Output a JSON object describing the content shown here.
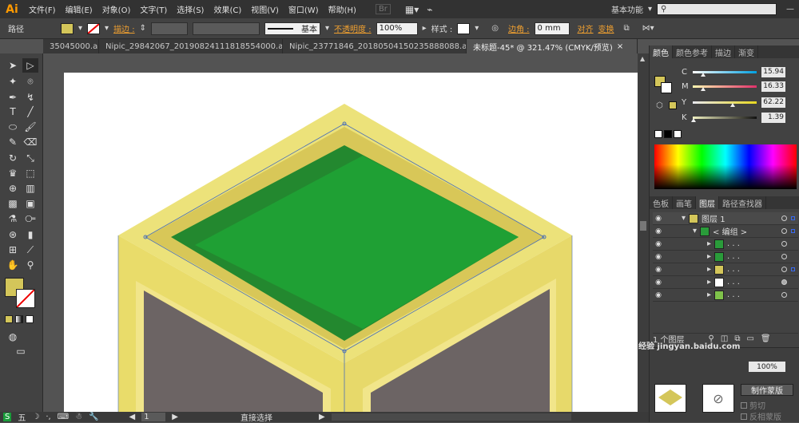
{
  "app": {
    "logo": "Ai"
  },
  "menu": [
    "文件(F)",
    "编辑(E)",
    "对象(O)",
    "文字(T)",
    "选择(S)",
    "效果(C)",
    "视图(V)",
    "窗口(W)",
    "帮助(H)"
  ],
  "menu_right": {
    "br": "Br",
    "workspace": "基本功能"
  },
  "control": {
    "path_label": "路径",
    "stroke_label": "描边 :",
    "stroke_style": "基本",
    "opacity_label": "不透明度 :",
    "opacity_value": "100%",
    "style_label": "样式 :",
    "corner_label": "边角 :",
    "corner_value": "0 mm",
    "align_label": "对齐",
    "transform_label": "变换",
    "fill_color": "#d4c65a"
  },
  "tabs": [
    {
      "label": "35045000.ai*",
      "active": false
    },
    {
      "label": "Nipic_29842067_20190824111818554000.ai*",
      "active": false
    },
    {
      "label": "Nipic_23771846_20180504150235888088.ai*",
      "active": false
    },
    {
      "label": "未标题-45* @ 321.47% (CMYK/预览)",
      "active": true
    }
  ],
  "color_panel": {
    "tabs": [
      "颜色",
      "颜色参考",
      "描边",
      "渐变"
    ],
    "channels": [
      {
        "name": "C",
        "value": "15.94",
        "percent": 15.94,
        "gradient": "linear-gradient(90deg,#fff,#00a0e0)"
      },
      {
        "name": "M",
        "value": "16.33",
        "percent": 16.33,
        "gradient": "linear-gradient(90deg,#fff8b0,#e0306a)"
      },
      {
        "name": "Y",
        "value": "62.22",
        "percent": 62.22,
        "gradient": "linear-gradient(90deg,#e8e8f0,#e8d820)"
      },
      {
        "name": "K",
        "value": "1.39",
        "percent": 1.39,
        "gradient": "linear-gradient(90deg,#f0f0c0,#111)"
      }
    ]
  },
  "layers_panel": {
    "tabs": [
      "色板",
      "画笔",
      "图层",
      "路径查找器"
    ],
    "layer1": "图层 1",
    "group": "< 编组 >",
    "items": [
      ". . .",
      ". . .",
      ". . .",
      ". . .",
      ". . ."
    ],
    "count": "1 个图层"
  },
  "bottom_panel": {
    "opacity": "100%",
    "make_mask": "制作蒙版",
    "clip": "剪切",
    "invert": "反相蒙版"
  },
  "status": {
    "ime": "五",
    "tool": "直接选择",
    "page": "1"
  },
  "watermark": "Bai du 经验 jingyan.baidu.com"
}
